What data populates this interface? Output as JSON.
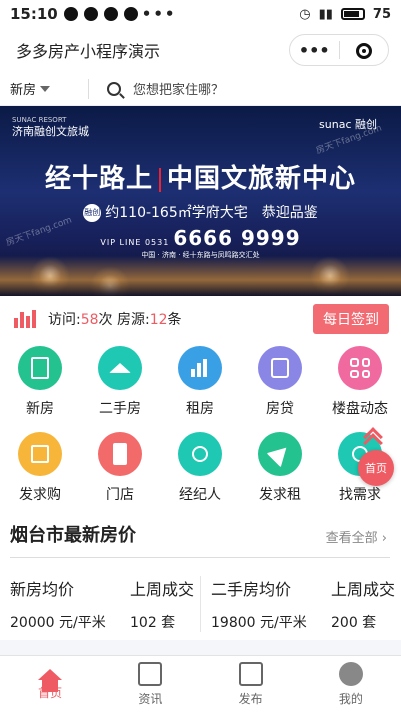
{
  "status": {
    "time": "15:10",
    "battery": "75"
  },
  "titlebar": {
    "title": "多多房产小程序演示",
    "more_label": "•••"
  },
  "search": {
    "city": "新房",
    "placeholder": "您想把家住哪？"
  },
  "banner": {
    "brand_left": "济南融创文旅城",
    "brand_left_small": "SUNAC RESORT",
    "brand_right": "sunac 融创",
    "headline_left": "经十路上",
    "headline_right": "中国文旅新中心",
    "sub_badge": "融创",
    "subline": "约110-165㎡学府大宅　恭迎品鉴",
    "vip": "VIP LINE 0531",
    "phone": "6666 9999",
    "address": "中国 · 济南 · 经十东路与凤鸣路交汇处",
    "watermark": "房天下fang.com"
  },
  "stats": {
    "visit_label": "访问:",
    "visits": "58",
    "visit_unit": "次 房源:",
    "listings": "12",
    "listing_unit": "条",
    "signin": "每日签到"
  },
  "menu": [
    {
      "label": "新房",
      "color": "#23c28e",
      "icon": "building-icon"
    },
    {
      "label": "二手房",
      "color": "#1ec8b2",
      "icon": "house-icon"
    },
    {
      "label": "租房",
      "color": "#3aa0e6",
      "icon": "chart-building-icon"
    },
    {
      "label": "房贷",
      "color": "#8a86e6",
      "icon": "calculator-icon"
    },
    {
      "label": "楼盘动态",
      "color": "#f06aa0",
      "icon": "grid-icon"
    },
    {
      "label": "发求购",
      "color": "#f7b53a",
      "icon": "note-icon"
    },
    {
      "label": "门店",
      "color": "#f26a6a",
      "icon": "store-icon"
    },
    {
      "label": "经纪人",
      "color": "#1ec8b2",
      "icon": "agent-icon"
    },
    {
      "label": "发求租",
      "color": "#23c28e",
      "icon": "send-icon"
    },
    {
      "label": "找需求",
      "color": "#1ec8b2",
      "icon": "find-icon"
    }
  ],
  "float_home": "首页",
  "section": {
    "title": "烟台市最新房价",
    "view_all": "查看全部 ›"
  },
  "prices": {
    "new_label": "新房均价",
    "new_value": "20000 元/平米",
    "new_week_label": "上周成交",
    "new_week_value": "102 套",
    "used_label": "二手房均价",
    "used_value": "19800 元/平米",
    "used_week_label": "上周成交",
    "used_week_value": "200 套"
  },
  "tabs": [
    {
      "label": "首页"
    },
    {
      "label": "资讯"
    },
    {
      "label": "发布"
    },
    {
      "label": "我的"
    }
  ]
}
